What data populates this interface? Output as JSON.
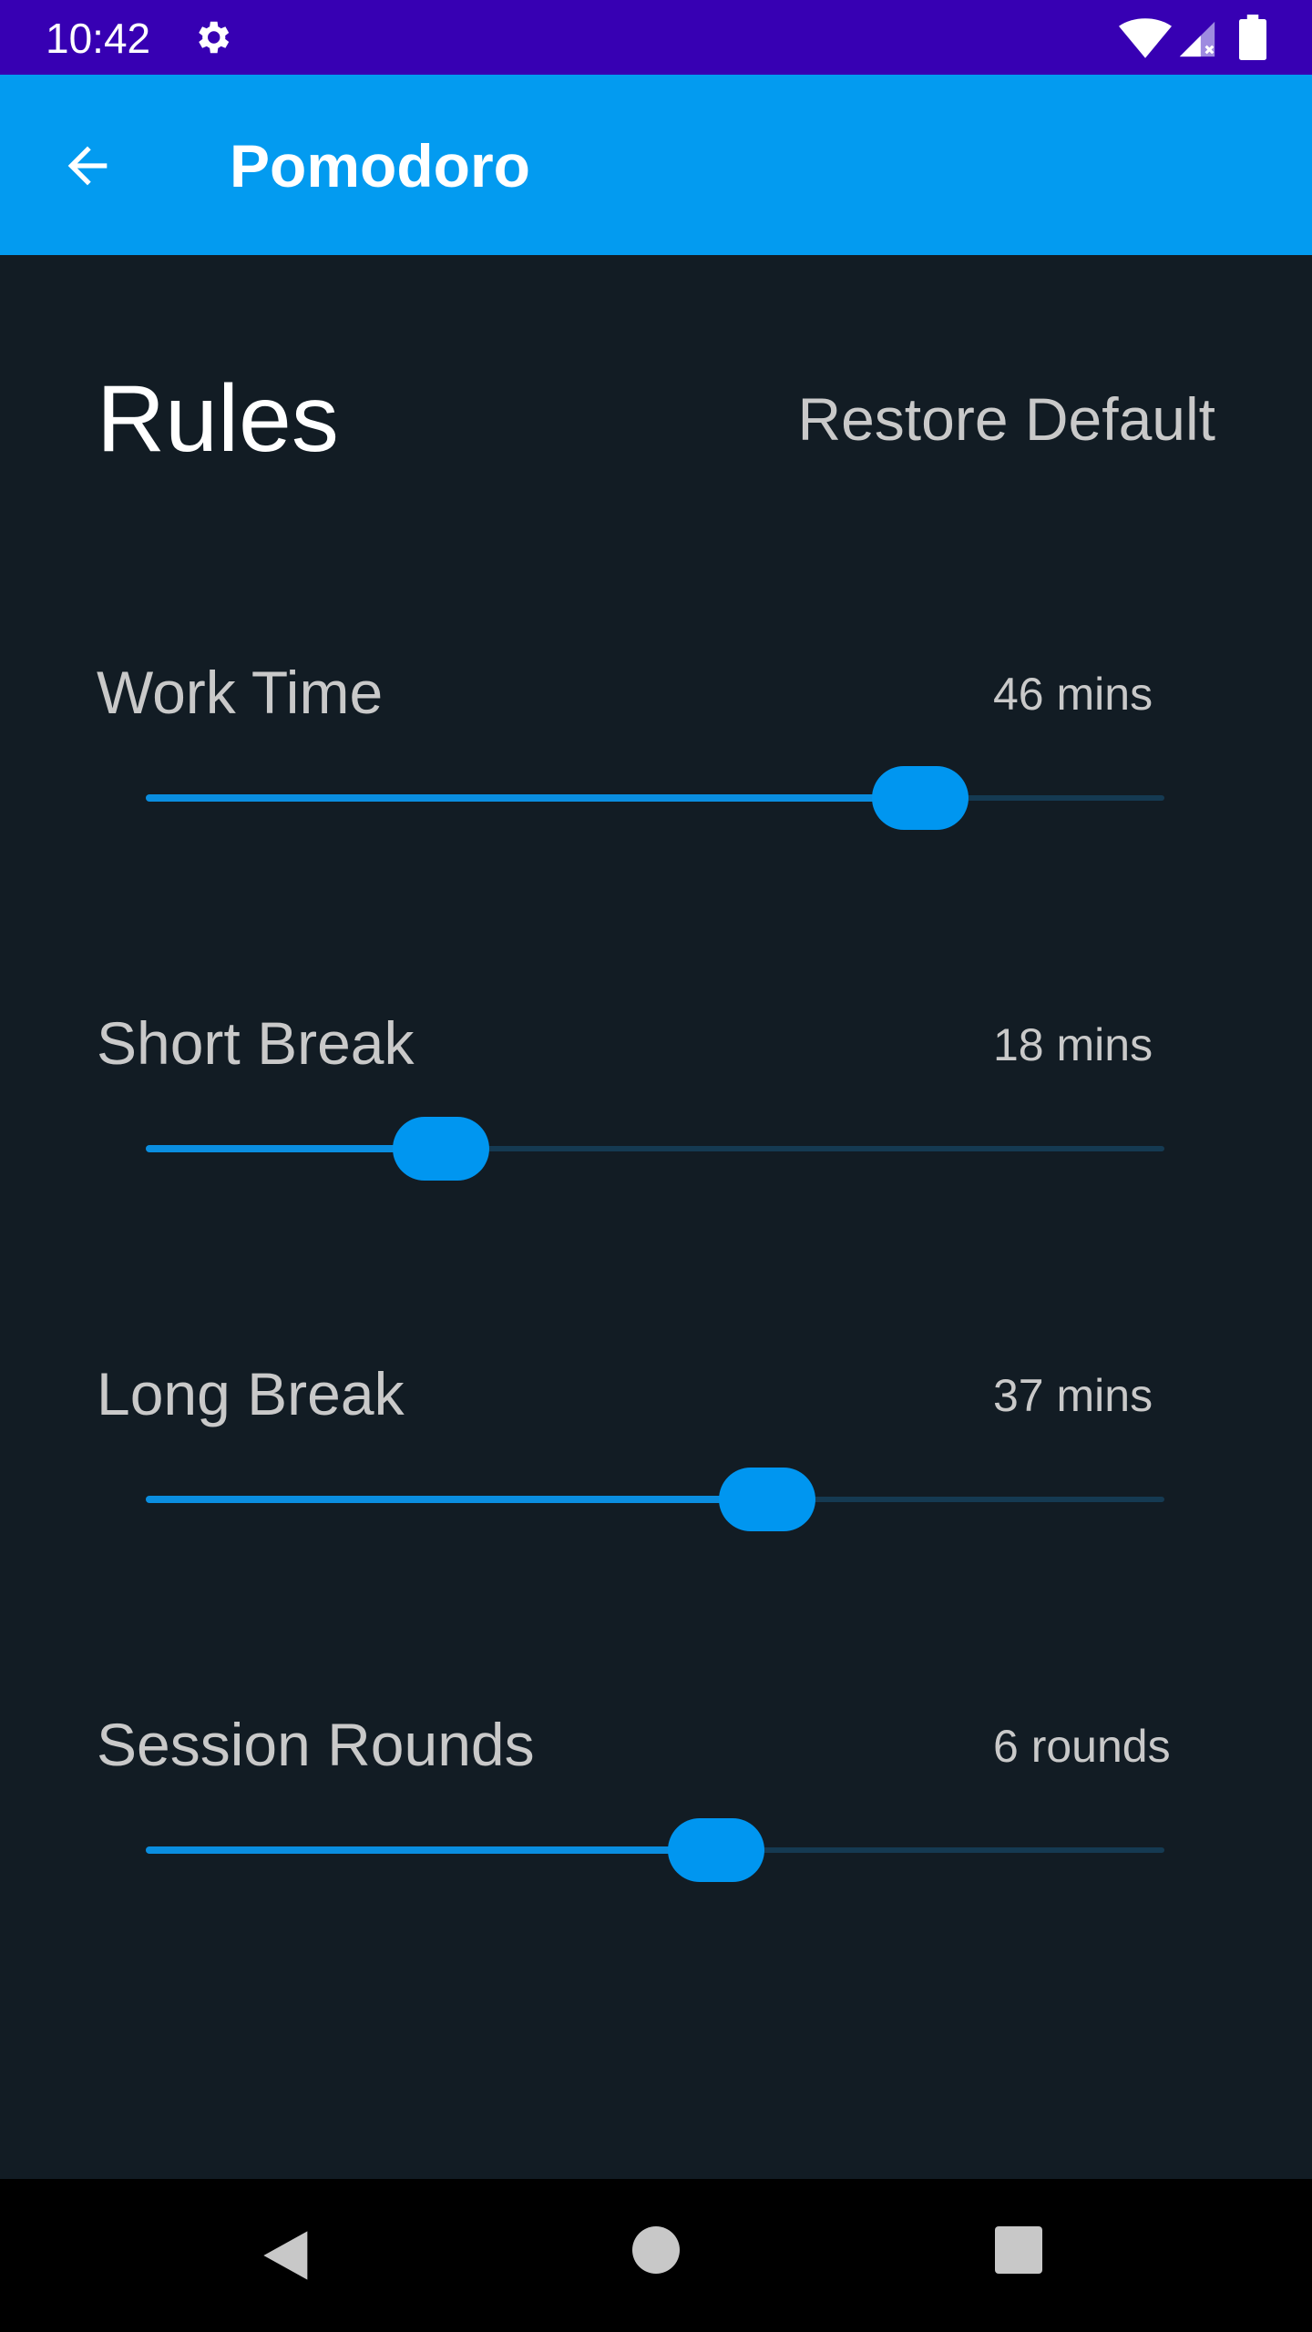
{
  "status_bar": {
    "time": "10:42",
    "icons": [
      "gear-icon",
      "wifi-icon",
      "signal-icon",
      "battery-icon"
    ],
    "background": "#3700b3"
  },
  "app_bar": {
    "title": "Pomodoro",
    "back_icon": "arrow-back-icon",
    "background": "#039bf0"
  },
  "rules": {
    "title": "Rules",
    "restore_label": "Restore Default"
  },
  "settings": [
    {
      "label": "Work Time",
      "value_text": "46 mins",
      "level": 0.76
    },
    {
      "label": "Short Break",
      "value_text": "18 mins",
      "level": 0.29
    },
    {
      "label": "Long Break",
      "value_text": "37 mins",
      "level": 0.61
    },
    {
      "label": "Session Rounds",
      "value_text": "6 rounds",
      "level": 0.56
    }
  ],
  "colors": {
    "background": "#121c24",
    "accent": "#0096f0",
    "track": "#153a52",
    "text_secondary": "#c9c9c9"
  },
  "nav_bar": {
    "icons": [
      "nav-back-icon",
      "nav-home-icon",
      "nav-recents-icon"
    ]
  }
}
